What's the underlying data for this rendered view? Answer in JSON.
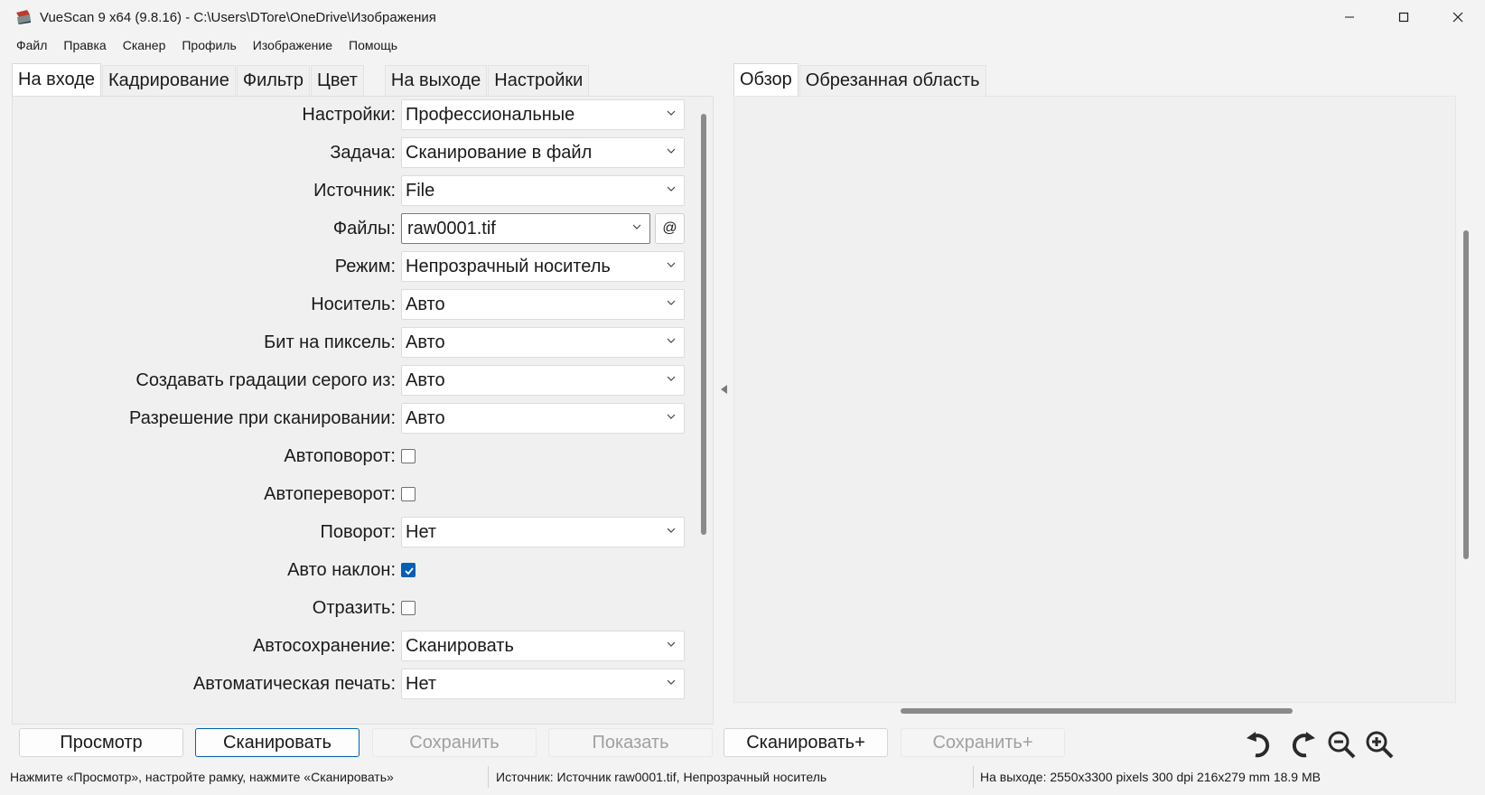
{
  "window": {
    "title": "VueScan 9 x64 (9.8.16) - C:\\Users\\DTore\\OneDrive\\Изображения",
    "app_icon": "vuescan-scanner-icon",
    "controls": {
      "minimize": "—",
      "maximize": "☐",
      "close": "✕"
    }
  },
  "menu": [
    "Файл",
    "Правка",
    "Сканер",
    "Профиль",
    "Изображение",
    "Помощь"
  ],
  "left_tabs": [
    "На входе",
    "Кадрирование",
    "Фильтр",
    "Цвет",
    "На выходе",
    "Настройки"
  ],
  "active_left_tab": "На входе",
  "form": {
    "settings": {
      "label": "Настройки:",
      "value": "Профессиональные"
    },
    "task": {
      "label": "Задача:",
      "value": "Сканирование в файл"
    },
    "source": {
      "label": "Источник:",
      "value": "File"
    },
    "files": {
      "label": "Файлы:",
      "value": "raw0001.tif",
      "at_button": "@"
    },
    "mode": {
      "label": "Режим:",
      "value": "Непрозрачный носитель"
    },
    "media": {
      "label": "Носитель:",
      "value": "Авто"
    },
    "bits": {
      "label": "Бит на пиксель:",
      "value": "Авто"
    },
    "grayscale": {
      "label": "Создавать градации серого из:",
      "value": "Авто"
    },
    "resolution": {
      "label": "Разрешение при сканировании:",
      "value": "Авто"
    },
    "auto_rotate": {
      "label": "Автоповорот:",
      "checked": false
    },
    "auto_flip": {
      "label": "Автопереворот:",
      "checked": false
    },
    "rotation": {
      "label": "Поворот:",
      "value": "Нет"
    },
    "auto_skew": {
      "label": "Авто наклон:",
      "checked": true
    },
    "mirror": {
      "label": "Отразить:",
      "checked": false
    },
    "autosave": {
      "label": "Автосохранение:",
      "value": "Сканировать"
    },
    "autoprint": {
      "label": "Автоматическая печать:",
      "value": "Нет"
    }
  },
  "right_tabs": [
    "Обзор",
    "Обрезанная область"
  ],
  "active_right_tab": "Обзор",
  "buttons": {
    "preview": "Просмотр",
    "scan": "Сканировать",
    "save": "Сохранить",
    "show": "Показать",
    "scan_plus": "Сканировать+",
    "save_plus": "Сохранить+"
  },
  "tool_icons": [
    "rotate-left-icon",
    "rotate-right-icon",
    "zoom-out-icon",
    "zoom-in-icon"
  ],
  "status": {
    "hint": "Нажмите «Просмотр», настройте рамку, нажмите «Сканировать»",
    "source": "Источник: Источник raw0001.tif, Непрозрачный носитель",
    "output": "На выходе: 2550x3300 pixels 300 dpi 216x279 mm 18.9 MB"
  },
  "colors": {
    "accent": "#005fb8",
    "background": "#f3f3f3",
    "panel": "#f0f0f0"
  }
}
